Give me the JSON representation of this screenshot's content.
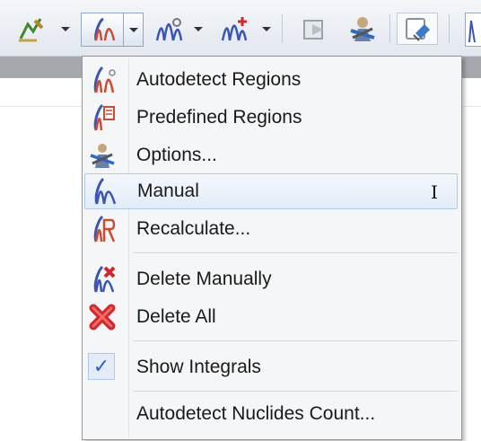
{
  "toolbar": {
    "buttons": [
      {
        "icon": "curve-tool-icon"
      },
      {
        "icon": "auto-regions-icon",
        "pressed": true
      },
      {
        "icon": "peak-search-icon"
      },
      {
        "icon": "add-peak-icon"
      },
      {
        "icon": "print-preview-icon"
      },
      {
        "icon": "options-wizard-icon"
      },
      {
        "icon": "eraser-icon"
      },
      {
        "icon": "spectrum-view-icon"
      }
    ]
  },
  "menu": {
    "items": [
      {
        "label": "Autodetect Regions",
        "icon": "autodetect-regions-icon"
      },
      {
        "label": "Predefined Regions",
        "icon": "predefined-regions-icon"
      },
      {
        "label": "Options...",
        "icon": "options-icon"
      },
      {
        "label": "Manual",
        "icon": "manual-integral-icon",
        "highlighted": true
      },
      {
        "label": "Recalculate...",
        "icon": "recalculate-icon"
      },
      {
        "label": "Delete Manually",
        "icon": "delete-manually-icon"
      },
      {
        "label": "Delete All",
        "icon": "delete-all-icon"
      },
      {
        "label": "Show Integrals",
        "checked": true
      },
      {
        "label": "Autodetect Nuclides Count..."
      }
    ]
  },
  "colors": {
    "integral_blue": "#3a55b5",
    "integral_red": "#d04a2f",
    "delete_red": "#d2282c",
    "highlight_border": "#aecbea",
    "check_blue": "#2a63c4"
  }
}
